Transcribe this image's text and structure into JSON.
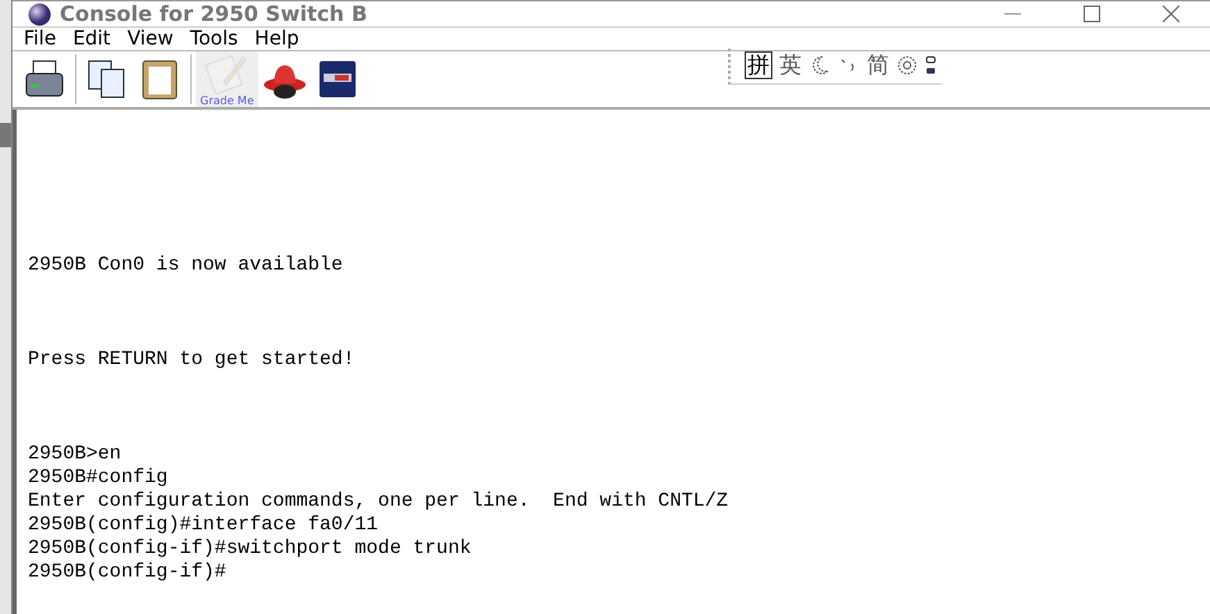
{
  "window": {
    "title": "Console for 2950 Switch B"
  },
  "menu": [
    "File",
    "Edit",
    "View",
    "Tools",
    "Help"
  ],
  "toolbar": {
    "tools": [
      {
        "kind": "print",
        "disabled": false
      },
      {
        "kind": "copy",
        "disabled": false
      },
      {
        "kind": "paste",
        "disabled": false
      },
      {
        "kind": "grade",
        "disabled": true,
        "label": "Grade Me"
      },
      {
        "kind": "hat",
        "disabled": false
      },
      {
        "kind": "monitor",
        "disabled": false
      }
    ],
    "ime": [
      {
        "kind": "char",
        "text": "拼",
        "boxed": true
      },
      {
        "kind": "char",
        "text": "英",
        "boxed": false
      },
      {
        "kind": "moon"
      },
      {
        "kind": "punct"
      },
      {
        "kind": "char",
        "text": "简",
        "boxed": false
      },
      {
        "kind": "gear"
      },
      {
        "kind": "dots"
      }
    ]
  },
  "terminal": {
    "blocks": [
      [
        "2950B Con0 is now available"
      ],
      [
        "Press RETURN to get started!"
      ],
      [
        "2950B>en",
        "2950B#config",
        "Enter configuration commands, one per line.  End with CNTL/Z",
        "2950B(config)#interface fa0/11",
        "2950B(config-if)#switchport mode trunk",
        "2950B(config-if)#"
      ]
    ]
  }
}
